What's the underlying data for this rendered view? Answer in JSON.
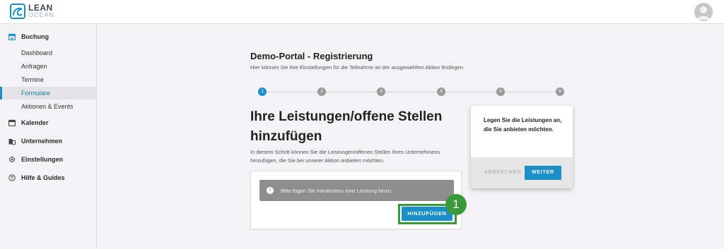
{
  "brand": {
    "name": "LEAN",
    "sub": "OCEAN"
  },
  "sidebar": {
    "groups": [
      {
        "label": "Buchung",
        "icon": "calendar-check-icon"
      },
      {
        "label": "Kalender",
        "icon": "calendar-icon"
      },
      {
        "label": "Unternehmen",
        "icon": "building-icon"
      },
      {
        "label": "Einstellungen",
        "icon": "gear-icon"
      },
      {
        "label": "Hilfe & Guides",
        "icon": "help-icon"
      }
    ],
    "items": [
      {
        "label": "Dashboard"
      },
      {
        "label": "Anfragen"
      },
      {
        "label": "Termine"
      },
      {
        "label": "Formulare",
        "active": true
      },
      {
        "label": "Aktionen & Events"
      }
    ]
  },
  "main": {
    "title": "Demo-Portal - Registrierung",
    "subtitle": "Hier können Sie ihre Einstellungen für die Teilnahme an der ausgewählten Aktion festlegen.",
    "steps": [
      "1",
      "2",
      "3",
      "4",
      "5",
      "6"
    ],
    "active_step": 1,
    "section_title": "Ihre Leistungen/offene Stellen hinzufügen",
    "section_desc": "In diesem Schritt können Sie die Leistungen/offenen Stellen Ihres Unternehmens hinzufügen, die Sie bei unserer Aktion anbieten möchten.",
    "alert_text": "Bitte fügen Sie mindestens eine Leistung hinzu.",
    "add_button": "HINZUFÜGEN",
    "badge": "1"
  },
  "popover": {
    "text": "Legen Sie die Leistungen an, die Sie anbieten möchten.",
    "cancel": "ABBRECHEN",
    "next": "WEITER"
  },
  "colors": {
    "accent": "#1a8fc8",
    "highlight": "#3a9a3a",
    "alert": "#8e8e8e"
  }
}
